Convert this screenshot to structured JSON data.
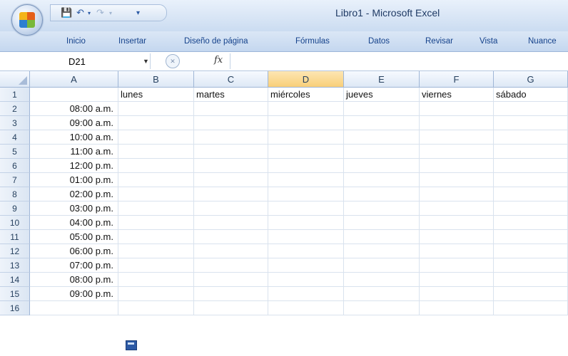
{
  "window": {
    "title": "Libro1 - Microsoft Excel"
  },
  "ribbon": {
    "tabs": [
      "Inicio",
      "Insertar",
      "Diseño de página",
      "Fórmulas",
      "Datos",
      "Revisar",
      "Vista",
      "Nuance"
    ]
  },
  "formula_bar": {
    "name_box": "D21",
    "fx_label": "fx",
    "value": ""
  },
  "sheet": {
    "columns": [
      "A",
      "B",
      "C",
      "D",
      "E",
      "F",
      "G"
    ],
    "selected_column": "D",
    "rows": [
      "1",
      "2",
      "3",
      "4",
      "5",
      "6",
      "7",
      "8",
      "9",
      "10",
      "11",
      "12",
      "13",
      "14",
      "15",
      "16"
    ],
    "days": [
      "lunes",
      "martes",
      "miércoles",
      "jueves",
      "viernes",
      "sábado"
    ],
    "times": [
      "08:00 a.m.",
      "09:00 a.m.",
      "10:00 a.m.",
      "11:00 a.m.",
      "12:00 p.m.",
      "01:00 p.m.",
      "02:00 p.m.",
      "03:00 p.m.",
      "04:00 p.m.",
      "05:00 p.m.",
      "06:00 p.m.",
      "07:00 p.m.",
      "08:00 p.m.",
      "09:00 p.m."
    ]
  },
  "colors": {
    "accent": "#15428b",
    "selected_header": "#f8cf79"
  }
}
